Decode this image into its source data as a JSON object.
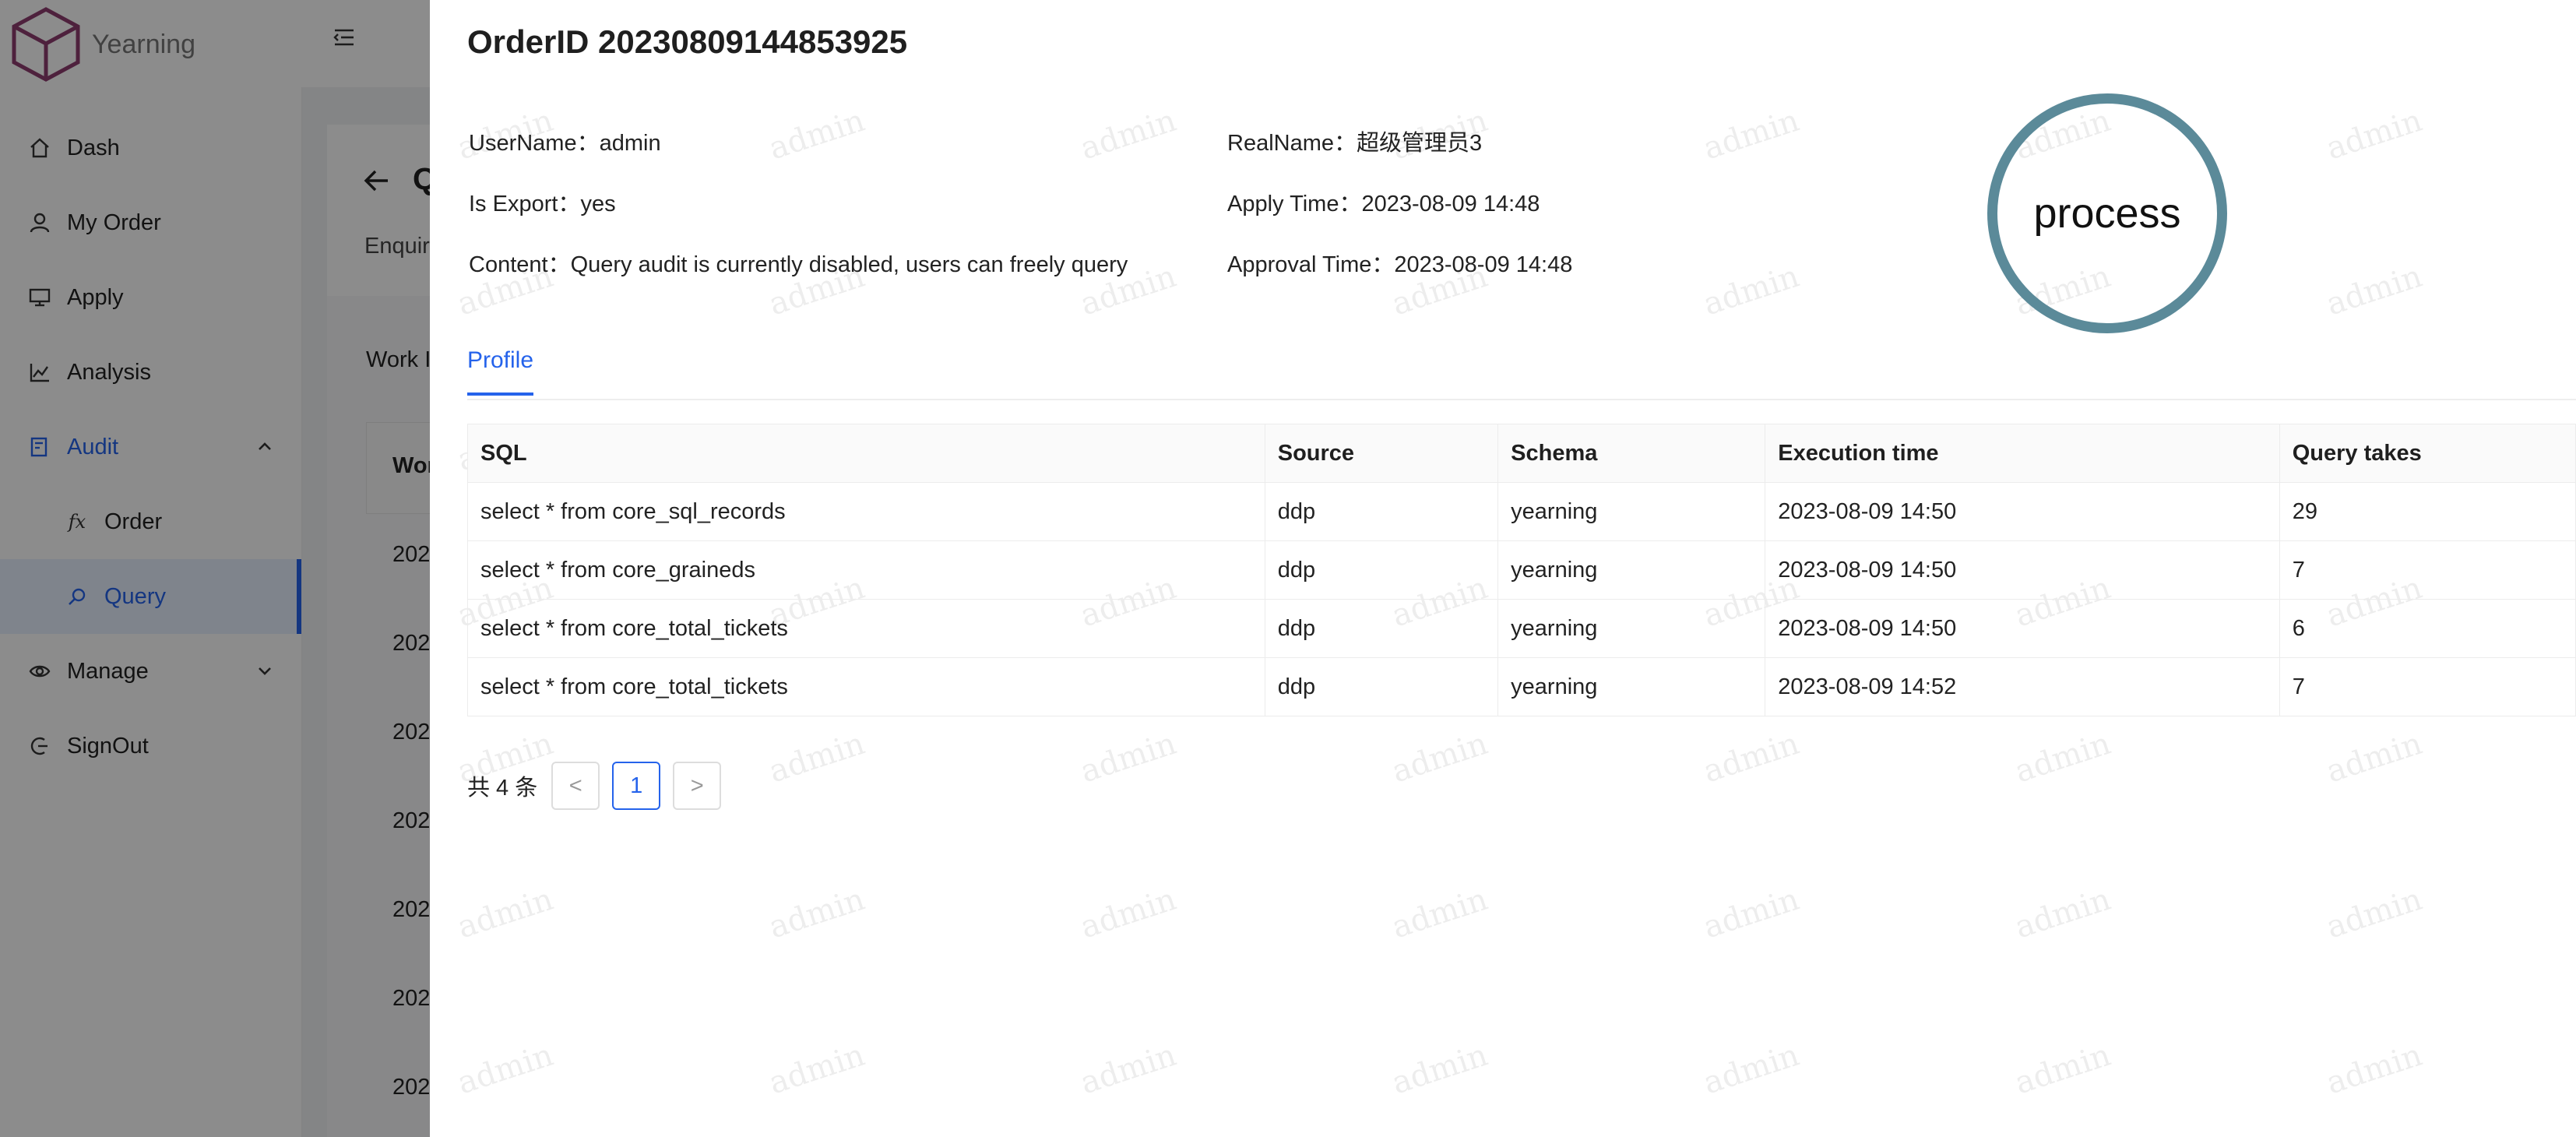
{
  "app": {
    "name": "Yearning"
  },
  "sidebar": {
    "items": [
      {
        "label": "Dash",
        "icon": "home-icon"
      },
      {
        "label": "My Order",
        "icon": "user-icon"
      },
      {
        "label": "Apply",
        "icon": "monitor-icon"
      },
      {
        "label": "Analysis",
        "icon": "chart-icon"
      },
      {
        "label": "Audit",
        "icon": "audit-icon",
        "expanded": true
      },
      {
        "label": "Order",
        "icon": "fx-icon",
        "sub": true
      },
      {
        "label": "Query",
        "icon": "search-icon",
        "sub": true,
        "selected": true
      },
      {
        "label": "Manage",
        "icon": "manage-icon"
      },
      {
        "label": "SignOut",
        "icon": "signout-icon"
      }
    ]
  },
  "background": {
    "title": "Q",
    "tab": "Enquir",
    "label": "Work I",
    "table_head": "Wor",
    "rows": [
      "202",
      "202",
      "202",
      "202",
      "202",
      "202",
      "202"
    ]
  },
  "drawer": {
    "title": "OrderID 20230809144853925",
    "info": {
      "username_label": "UserName：",
      "username": "admin",
      "realname_label": "RealName：",
      "realname": "超级管理员3",
      "export_label": "Is Export：",
      "export": "yes",
      "apply_time_label": "Apply Time：",
      "apply_time": "2023-08-09 14:48",
      "content_label": "Content：",
      "content": "Query audit is currently disabled, users can freely query",
      "approval_time_label": "Approval Time：",
      "approval_time": "2023-08-09 14:48"
    },
    "stamp": "process",
    "tabs": [
      "Profile"
    ],
    "table": {
      "columns": [
        "SQL",
        "Source",
        "Schema",
        "Execution time",
        "Query takes"
      ],
      "rows": [
        [
          "select * from core_sql_records",
          "ddp",
          "yearning",
          "2023-08-09 14:50",
          "29"
        ],
        [
          "select * from core_graineds",
          "ddp",
          "yearning",
          "2023-08-09 14:50",
          "7"
        ],
        [
          "select * from core_total_tickets",
          "ddp",
          "yearning",
          "2023-08-09 14:50",
          "6"
        ],
        [
          "select * from core_total_tickets",
          "ddp",
          "yearning",
          "2023-08-09 14:52",
          "7"
        ]
      ]
    },
    "pagination": {
      "total_text": "共 4 条",
      "current_page": "1",
      "prev": "<",
      "next": ">"
    },
    "watermark": "admin"
  },
  "colors": {
    "accent": "#2563eb",
    "stamp_ring": "#5b8a99"
  }
}
